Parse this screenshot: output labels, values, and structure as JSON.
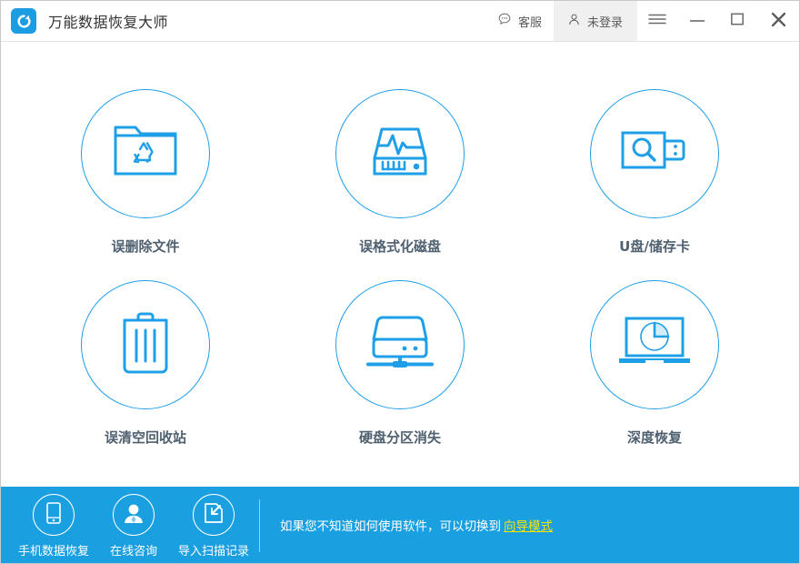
{
  "window": {
    "title": "万能数据恢复大师",
    "logo_icon": "recovery-circular-arrow-logo",
    "accent_color": "#1a9fe0",
    "card_border_color": "#1e9fe8",
    "card_label_color": "#4f6070",
    "link_color": "#ffe400"
  },
  "titlebar": {
    "support": {
      "label": "客服",
      "icon": "chat-bubble-icon"
    },
    "account": {
      "label": "未登录",
      "icon": "user-icon"
    },
    "menu": {
      "icon": "hamburger-menu-icon"
    },
    "minimize": {
      "icon": "minimize-icon"
    },
    "maximize": {
      "icon": "maximize-icon"
    },
    "close": {
      "icon": "close-icon"
    }
  },
  "main": {
    "cards": [
      {
        "label": "误删除文件",
        "icon": "folder-recycle-icon"
      },
      {
        "label": "误格式化磁盘",
        "icon": "disk-waveform-icon"
      },
      {
        "label": "U盘/储存卡",
        "icon": "usb-search-icon"
      },
      {
        "label": "误清空回收站",
        "icon": "trash-bin-icon"
      },
      {
        "label": "硬盘分区消失",
        "icon": "hard-disk-stand-icon"
      },
      {
        "label": "深度恢复",
        "icon": "laptop-pie-icon"
      }
    ]
  },
  "bottombar": {
    "actions": [
      {
        "label": "手机数据恢复",
        "icon": "mobile-phone-icon"
      },
      {
        "label": "在线咨询",
        "icon": "person-avatar-icon"
      },
      {
        "label": "导入扫描记录",
        "icon": "import-document-icon"
      }
    ],
    "hint_text": "如果您不知道如何使用软件，可以切换到",
    "hint_link": "向导模式"
  }
}
